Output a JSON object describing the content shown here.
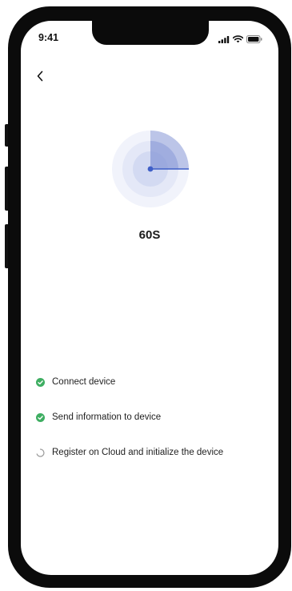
{
  "status_bar": {
    "time": "9:41",
    "icons": [
      "signal-icon",
      "wifi-icon",
      "battery-icon"
    ]
  },
  "nav": {
    "back_icon": "back-chevron-icon"
  },
  "progress": {
    "countdown": "60S",
    "radar_icon": "radar-scan-icon"
  },
  "steps": [
    {
      "label": "Connect device",
      "status": "done",
      "icon": "check-circle-icon"
    },
    {
      "label": "Send information to device",
      "status": "done",
      "icon": "check-circle-icon"
    },
    {
      "label": "Register on Cloud and initialize the device",
      "status": "in-progress",
      "icon": "loading-spinner-icon"
    }
  ],
  "colors": {
    "success": "#3fae62",
    "radar_accent": "#3f5fc7",
    "radar_ring": "#c8d0ef",
    "pending": "#9a9a9a"
  }
}
